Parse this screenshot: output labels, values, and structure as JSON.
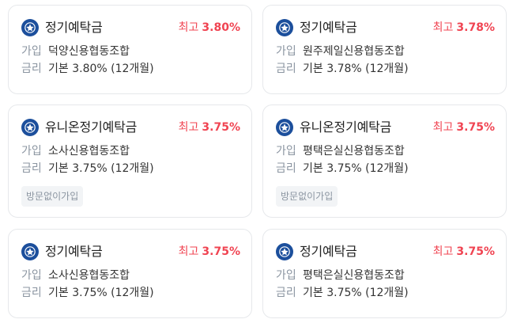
{
  "colors": {
    "accent_red": "#f04452",
    "logo_blue": "#1c4f9c",
    "label_gray": "#8b95a1",
    "badge_bg": "#f2f4f6"
  },
  "logo_icon": "credit-union-logo-icon",
  "cards": [
    {
      "product": "정기예탁금",
      "max_label": "최고",
      "max_rate": "3.80%",
      "join_label": "가입",
      "institution": "덕양신용협동조합",
      "rate_label": "금리",
      "base_rate": "기본 3.80% (12개월)"
    },
    {
      "product": "정기예탁금",
      "max_label": "최고",
      "max_rate": "3.78%",
      "join_label": "가입",
      "institution": "원주제일신용협동조합",
      "rate_label": "금리",
      "base_rate": "기본 3.78% (12개월)"
    },
    {
      "product": "유니온정기예탁금",
      "max_label": "최고",
      "max_rate": "3.75%",
      "join_label": "가입",
      "institution": "소사신용협동조합",
      "rate_label": "금리",
      "base_rate": "기본 3.75% (12개월)",
      "badge": "방문없이가입"
    },
    {
      "product": "유니온정기예탁금",
      "max_label": "최고",
      "max_rate": "3.75%",
      "join_label": "가입",
      "institution": "평택은실신용협동조합",
      "rate_label": "금리",
      "base_rate": "기본 3.75% (12개월)",
      "badge": "방문없이가입"
    },
    {
      "product": "정기예탁금",
      "max_label": "최고",
      "max_rate": "3.75%",
      "join_label": "가입",
      "institution": "소사신용협동조합",
      "rate_label": "금리",
      "base_rate": "기본 3.75% (12개월)"
    },
    {
      "product": "정기예탁금",
      "max_label": "최고",
      "max_rate": "3.75%",
      "join_label": "가입",
      "institution": "평택은실신용협동조합",
      "rate_label": "금리",
      "base_rate": "기본 3.75% (12개월)"
    }
  ]
}
